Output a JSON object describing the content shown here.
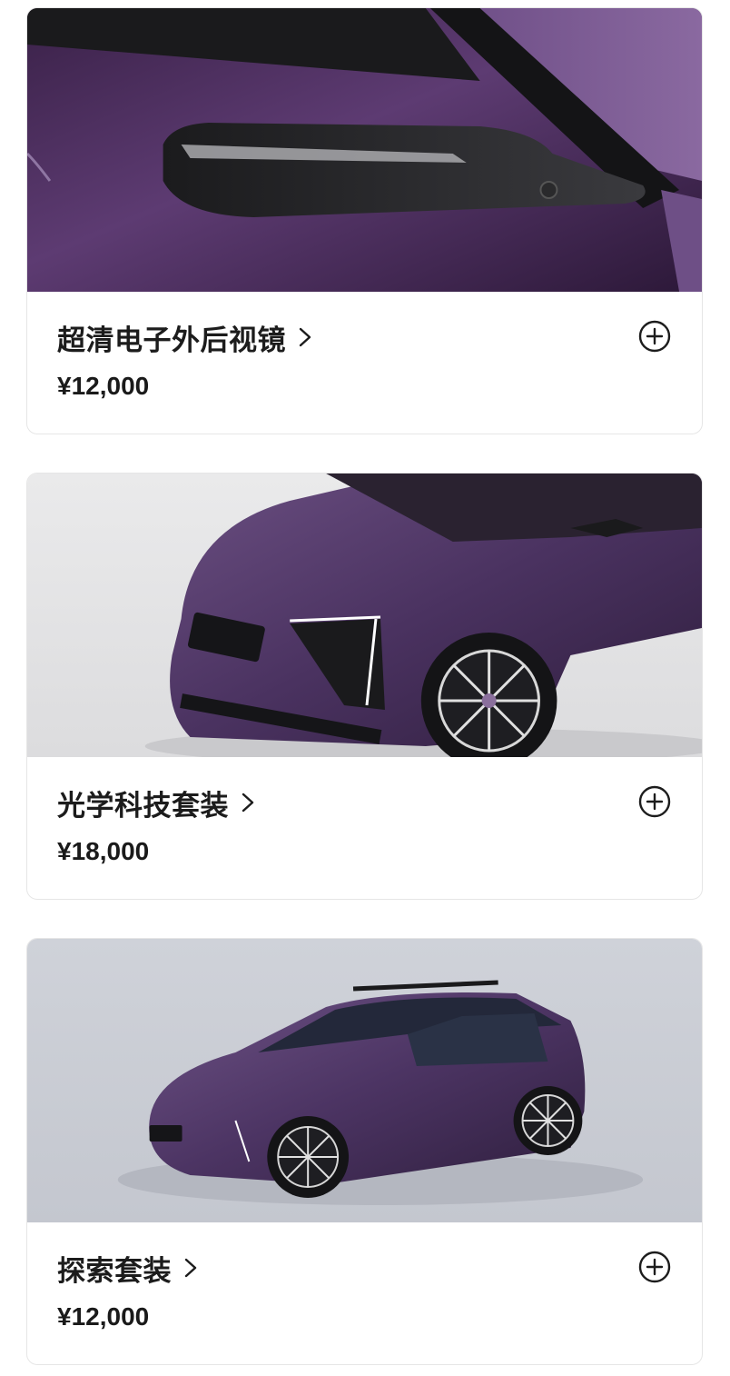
{
  "accessories": [
    {
      "title": "超清电子外后视镜",
      "price": "¥12,000",
      "image_icon": "side-mirror-image",
      "add_icon": "plus-circle-icon"
    },
    {
      "title": "光学科技套装",
      "price": "¥18,000",
      "image_icon": "car-front-image",
      "add_icon": "plus-circle-icon"
    },
    {
      "title": "探索套装",
      "price": "¥12,000",
      "image_icon": "car-side-image",
      "add_icon": "plus-circle-icon"
    }
  ],
  "colors": {
    "body_purple": "#4a2f5e",
    "text": "#1c1c1c",
    "border": "#e6e6e6"
  }
}
